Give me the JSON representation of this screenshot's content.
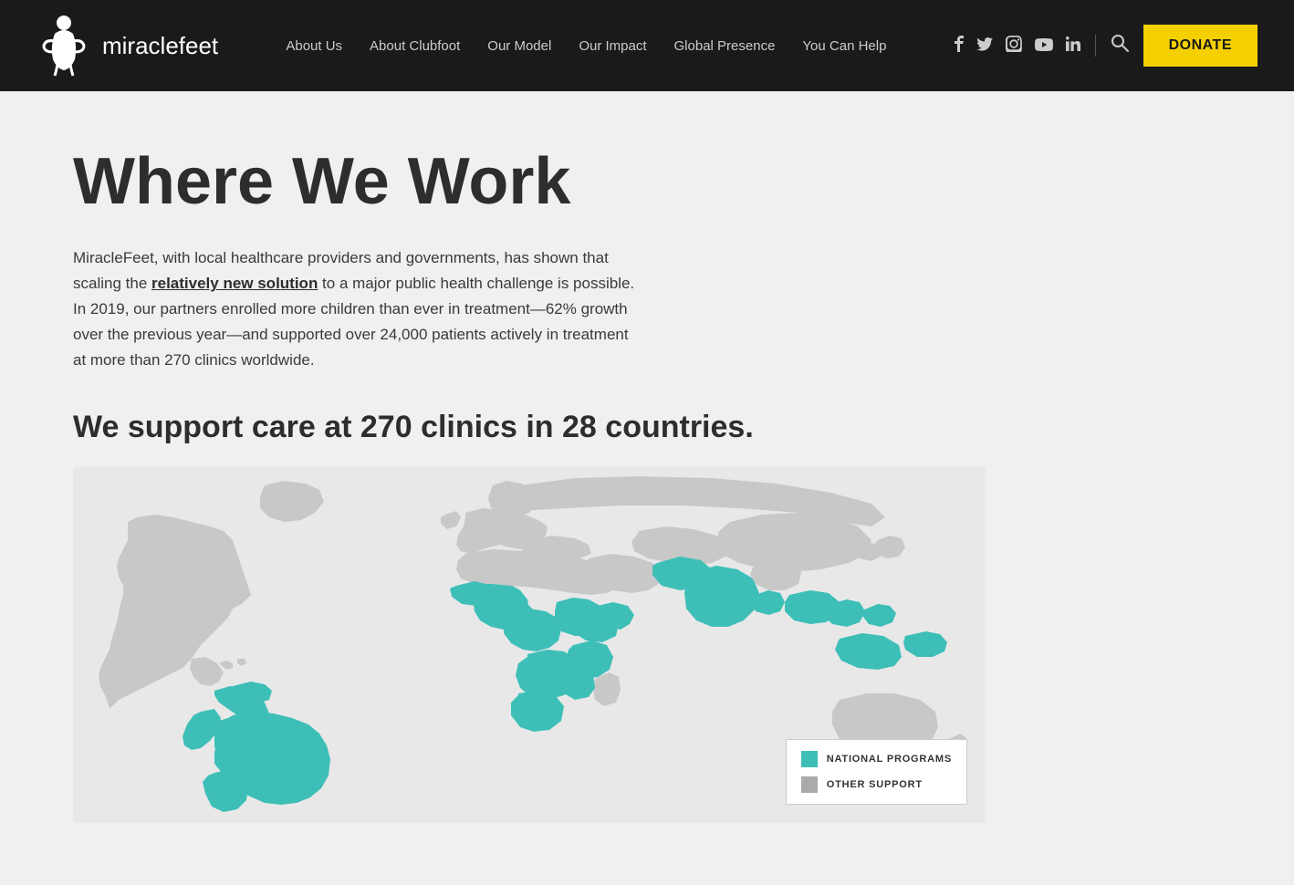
{
  "header": {
    "logo_text": "miraclefeet",
    "nav_items": [
      {
        "label": "About Us",
        "id": "about-us"
      },
      {
        "label": "About Clubfoot",
        "id": "about-clubfoot"
      },
      {
        "label": "Our Model",
        "id": "our-model"
      },
      {
        "label": "Our Impact",
        "id": "our-impact"
      },
      {
        "label": "Global Presence",
        "id": "global-presence"
      },
      {
        "label": "You Can Help",
        "id": "you-can-help"
      }
    ],
    "donate_label": "Donate",
    "social": {
      "facebook": "f",
      "twitter": "t",
      "instagram": "i",
      "youtube": "y",
      "linkedin": "in"
    }
  },
  "main": {
    "page_title": "Where We Work",
    "intro_paragraph": "MiracleFeet, with local healthcare providers and governments, has shown that scaling the ",
    "link_text": "relatively new solution",
    "intro_paragraph_2": " to a major public health challenge is possible. In 2019, our partners enrolled more children than ever in treatment—62% growth over the previous year—and supported over 24,000 patients actively in treatment at more than 270 clinics worldwide.",
    "support_heading": "We support care at 270 clinics in 28 countries.",
    "legend": {
      "national_programs_label": "NATIONAL PROGRAMS",
      "other_support_label": "OTHER SUPPORT"
    }
  }
}
